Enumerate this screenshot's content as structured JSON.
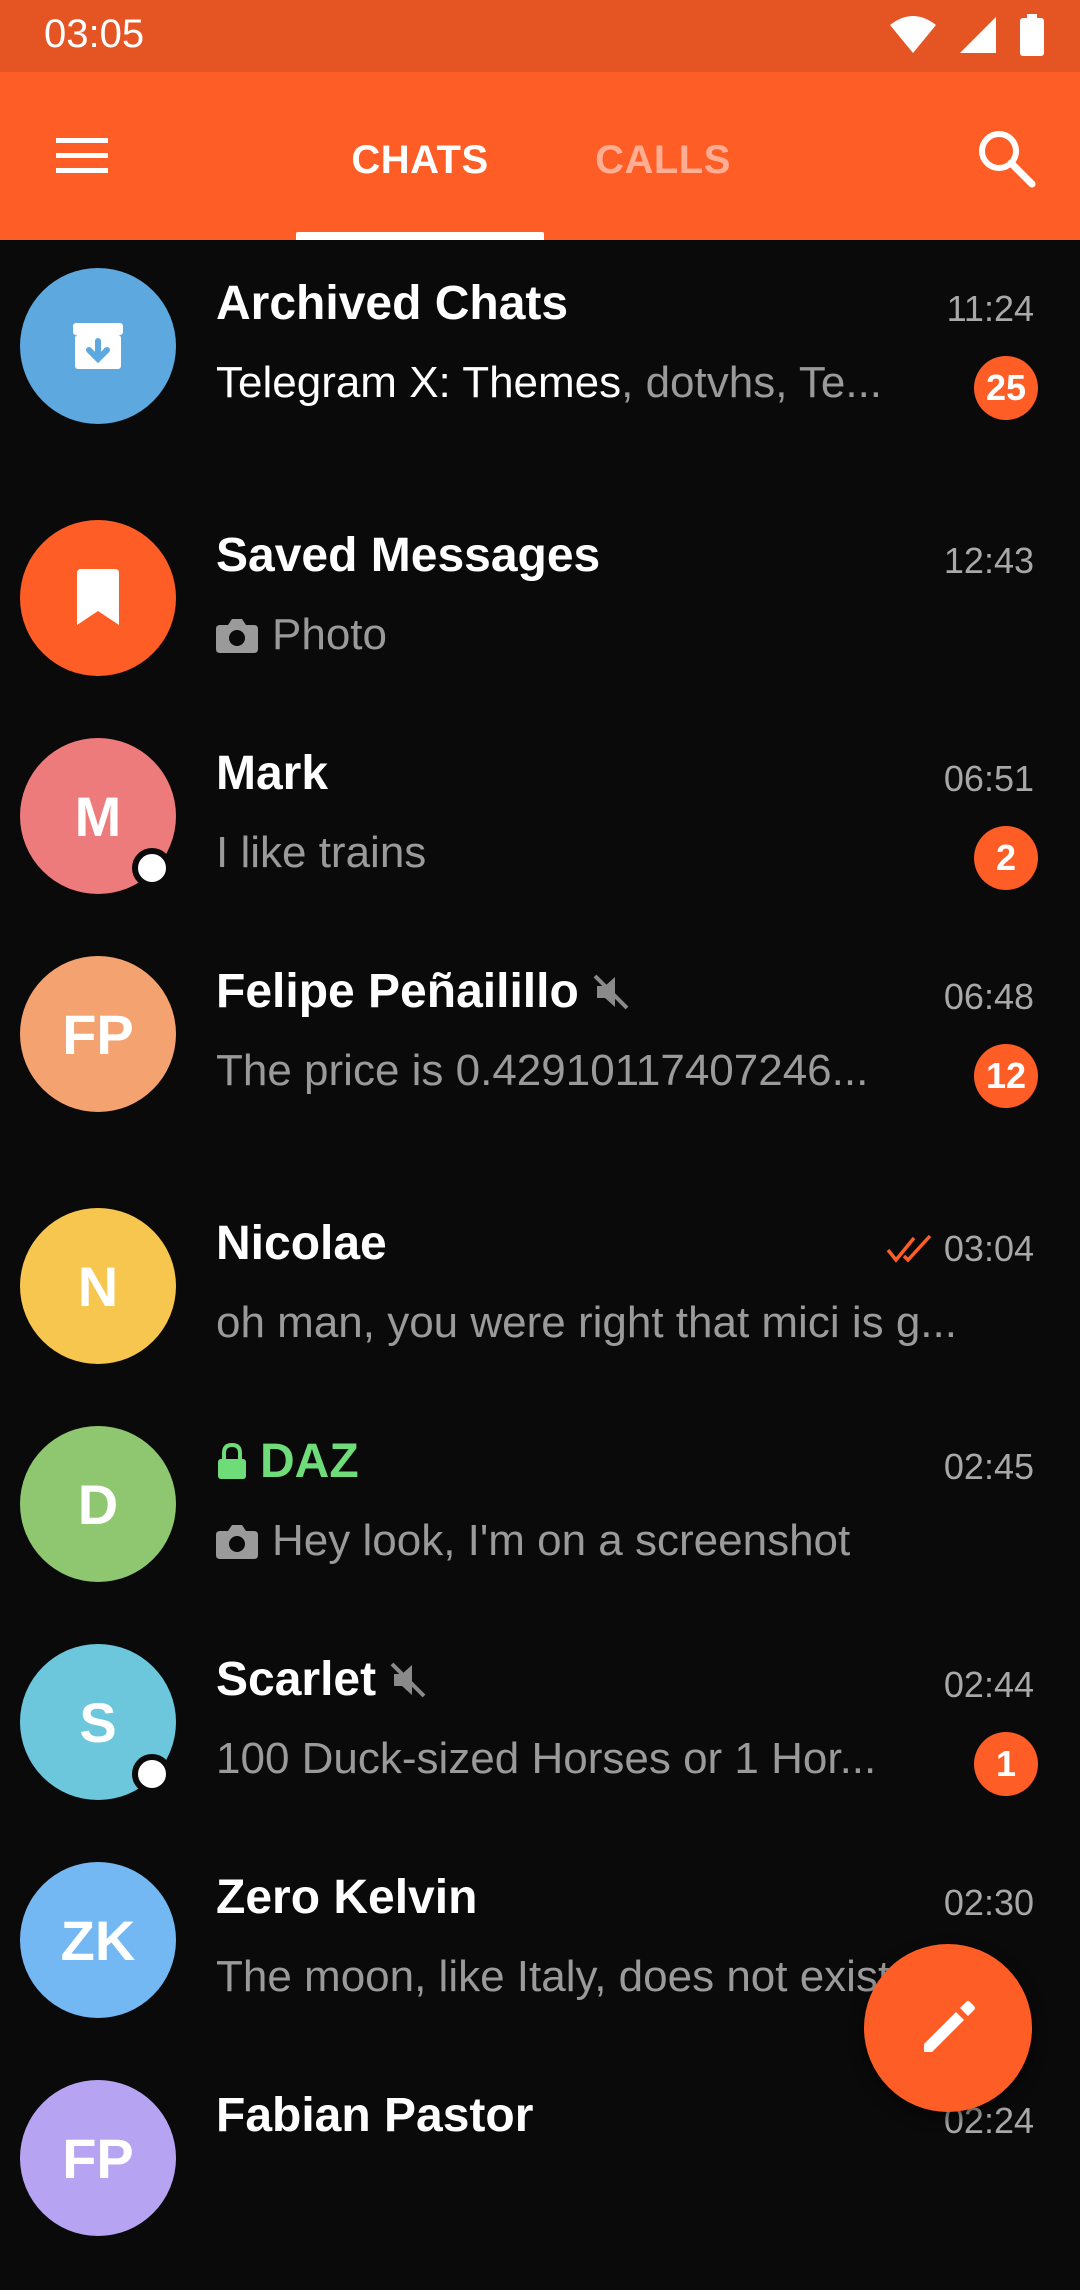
{
  "status_bar": {
    "time": "03:05"
  },
  "app_bar": {
    "tabs": [
      {
        "label": "CHATS",
        "active": true
      },
      {
        "label": "CALLS",
        "active": false
      }
    ]
  },
  "chats": [
    {
      "name": "Archived Chats",
      "time": "11:24",
      "preview_bright": "Telegram X: Themes",
      "preview": ", dotvhs, Te...",
      "badge": "25",
      "avatar_color": "#5ea8e0",
      "avatar_icon": "archive-icon"
    },
    {
      "name": "Saved Messages",
      "time": "12:43",
      "preview": "Photo",
      "preview_icon": "camera-icon",
      "avatar_color": "#ff5d26",
      "avatar_icon": "bookmark-icon"
    },
    {
      "name": "Mark",
      "initials": "M",
      "time": "06:51",
      "preview": "I like trains",
      "badge": "2",
      "online": true,
      "avatar_color": "#ee7b7b"
    },
    {
      "name": "Felipe Peñailillo",
      "initials": "FP",
      "time": "06:48",
      "preview": "The price is 0.42910117407246...",
      "badge": "12",
      "muted": true,
      "avatar_color": "#f4a370"
    },
    {
      "name": "Nicolae",
      "initials": "N",
      "time": "03:04",
      "read_status": "double-check-icon",
      "preview": "oh man, you were right that mici is g...",
      "avatar_color": "#f7c64e"
    },
    {
      "name": "DAZ",
      "initials": "D",
      "time": "02:45",
      "secret": true,
      "preview": "Hey look, I'm on a screenshot",
      "preview_icon": "camera-icon",
      "avatar_color": "#8ec76f"
    },
    {
      "name": "Scarlet",
      "initials": "S",
      "time": "02:44",
      "preview": "100 Duck-sized Horses or 1 Hor...",
      "badge": "1",
      "muted": true,
      "online": true,
      "avatar_color": "#6cc7dc"
    },
    {
      "name": "Zero Kelvin",
      "initials": "ZK",
      "time": "02:30",
      "preview": "The moon, like Italy, does not exist",
      "avatar_color": "#74b8f3"
    },
    {
      "name": "Fabian Pastor",
      "initials": "FP",
      "time": "02:24",
      "preview": "",
      "avatar_color": "#b6a4f2"
    }
  ],
  "colors": {
    "accent": "#ff5d26",
    "status_bar": "#e55524",
    "background": "#0a0a0b",
    "secret_green": "#6fdc7a"
  }
}
